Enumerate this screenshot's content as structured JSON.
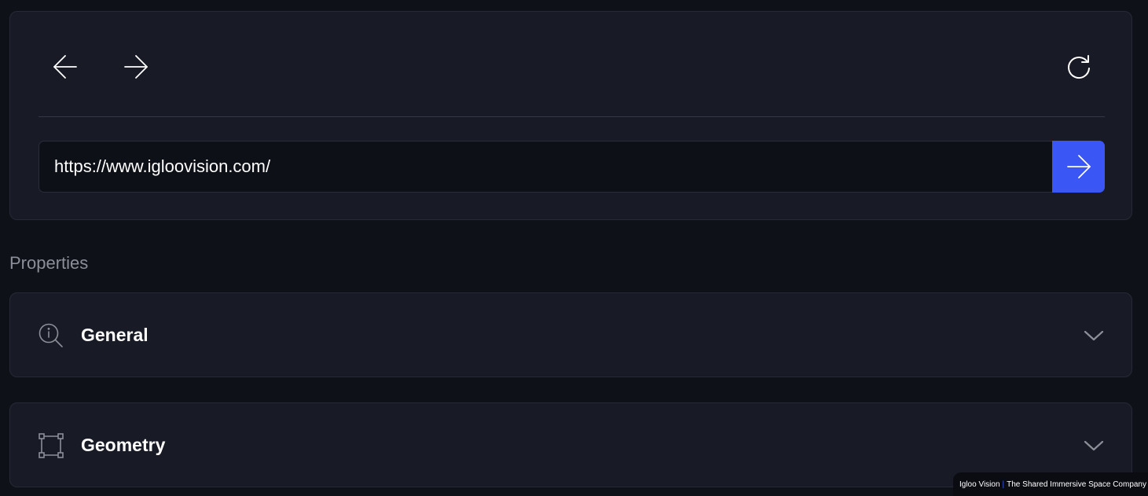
{
  "browser": {
    "url": "https://www.igloovision.com/",
    "back_icon": "arrow-left-icon",
    "forward_icon": "arrow-right-icon",
    "reload_icon": "refresh-icon",
    "go_icon": "arrow-right-icon",
    "accent_color": "#3a56f5"
  },
  "properties": {
    "title": "Properties",
    "sections": [
      {
        "label": "General",
        "icon": "info-search-icon",
        "expanded": false
      },
      {
        "label": "Geometry",
        "icon": "bounding-box-icon",
        "expanded": false
      }
    ]
  },
  "footer": {
    "brand": "Igloo Vision",
    "separator": "|",
    "tagline": "The Shared Immersive Space Company"
  }
}
